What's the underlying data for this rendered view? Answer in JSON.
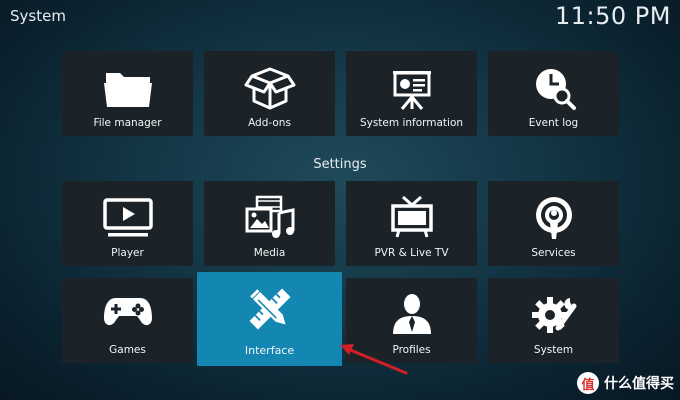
{
  "header": {
    "title": "System",
    "clock": "11:50 PM"
  },
  "top_row": [
    {
      "label": "File manager",
      "icon": "folder-icon"
    },
    {
      "label": "Add-ons",
      "icon": "box-icon"
    },
    {
      "label": "System information",
      "icon": "presentation-icon"
    },
    {
      "label": "Event log",
      "icon": "clock-search-icon"
    }
  ],
  "settings": {
    "heading": "Settings",
    "row1": [
      {
        "label": "Player",
        "icon": "tv-play-icon"
      },
      {
        "label": "Media",
        "icon": "media-icon"
      },
      {
        "label": "PVR & Live TV",
        "icon": "tv-antenna-icon"
      },
      {
        "label": "Services",
        "icon": "podcast-icon"
      }
    ],
    "row2": [
      {
        "label": "Games",
        "icon": "gamepad-icon"
      },
      {
        "label": "Interface",
        "icon": "pencil-ruler-icon",
        "focused": true
      },
      {
        "label": "Profiles",
        "icon": "user-icon"
      },
      {
        "label": "System",
        "icon": "gear-wrench-icon"
      }
    ]
  },
  "colors": {
    "focus": "#1387b2",
    "tile": "#1b2328",
    "arrow": "#d21f26"
  },
  "watermark": {
    "badge": "值",
    "text": "什么值得买"
  }
}
